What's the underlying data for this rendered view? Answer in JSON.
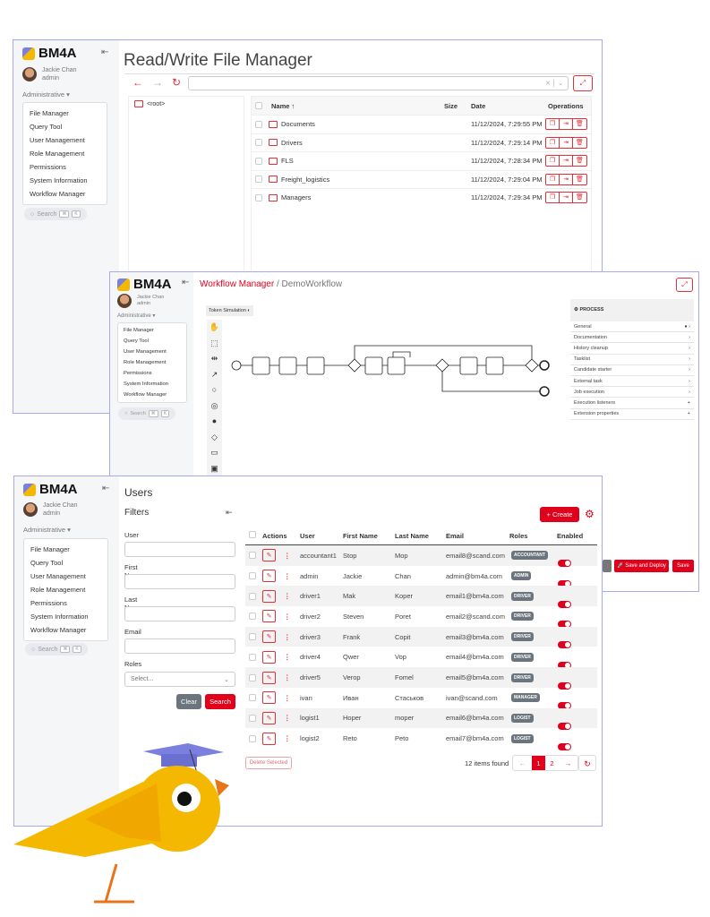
{
  "brand": "BM4A",
  "user": {
    "name": "Jackie Chan",
    "role": "admin"
  },
  "admin_menu": "Administrative ▾",
  "menu": [
    "File Manager",
    "Query Tool",
    "User Management",
    "Role Management",
    "Permissions",
    "System Information",
    "Workflow Manager"
  ],
  "search": {
    "label": "Search",
    "k1": "⌘",
    "k2": "K"
  },
  "file_manager": {
    "title": "Read/Write File Manager",
    "root": "<root>",
    "columns": {
      "name": "Name ↑",
      "size": "Size",
      "date": "Date",
      "ops": "Operations"
    },
    "rows": [
      {
        "name": "Documents",
        "date": "11/12/2024, 7:29:55 PM"
      },
      {
        "name": "Drivers",
        "date": "11/12/2024, 7:29:14 PM"
      },
      {
        "name": "FLS",
        "date": "11/12/2024, 7:28:34 PM"
      },
      {
        "name": "Freight_logistics",
        "date": "11/12/2024, 7:29:04 PM"
      },
      {
        "name": "Managers",
        "date": "11/12/2024, 7:29:34 PM"
      }
    ]
  },
  "workflow": {
    "crumb": "Workflow Manager",
    "sep": " / ",
    "name": "DemoWorkflow",
    "token_sim": "Token Simulation",
    "process": "PROCESS",
    "props": [
      {
        "l": "General",
        "i": "● ›"
      },
      {
        "l": "Documentation",
        "i": "›"
      },
      {
        "l": "History cleanup",
        "i": "›"
      },
      {
        "l": "Tasklist",
        "i": "›"
      },
      {
        "l": "Candidate starter",
        "i": "›"
      },
      {
        "l": "External task",
        "i": "›"
      },
      {
        "l": "Job execution",
        "i": "›"
      },
      {
        "l": "Execution listeners",
        "i": "+"
      },
      {
        "l": "Extension properties",
        "i": "+"
      }
    ],
    "save_deploy": "Save and Deploy",
    "save": "Save"
  },
  "users": {
    "title": "Users",
    "filters": "Filters",
    "f_user": "User",
    "f_first": "First Name",
    "f_last": "Last Name",
    "f_email": "Email",
    "f_roles": "Roles",
    "select_ph": "Select...",
    "clear": "Clear",
    "search": "Search",
    "create": "+ Create",
    "columns": [
      "Actions",
      "User",
      "First Name",
      "Last Name",
      "Email",
      "Roles",
      "Enabled"
    ],
    "rows": [
      [
        "accountant1",
        "Stop",
        "Mop",
        "email8@scand.com",
        "ACCOUNTANT"
      ],
      [
        "admin",
        "Jackie",
        "Chan",
        "admin@bm4a.com",
        "ADMIN"
      ],
      [
        "driver1",
        "Mak",
        "Koper",
        "email1@bm4a.com",
        "DRIVER"
      ],
      [
        "driver2",
        "Steven",
        "Poret",
        "email2@scand.com",
        "DRIVER"
      ],
      [
        "driver3",
        "Frank",
        "Copit",
        "email3@bm4a.com",
        "DRIVER"
      ],
      [
        "driver4",
        "Qwer",
        "Vop",
        "email4@bm4a.com",
        "DRIVER"
      ],
      [
        "driver5",
        "Verop",
        "Fomel",
        "email5@bm4a.com",
        "DRIVER"
      ],
      [
        "ivan",
        "Иван",
        "Стаськов",
        "ivan@scand.com",
        "MANAGER"
      ],
      [
        "logist1",
        "Hoper",
        "moper",
        "email6@bm4a.com",
        "LOGIST"
      ],
      [
        "logist2",
        "Reto",
        "Peto",
        "email7@bm4a.com",
        "LOGIST"
      ]
    ],
    "delete_selected": "Delete Selected",
    "found": "12 items found",
    "pages": [
      "1",
      "2"
    ]
  },
  "colors": {
    "accent": "#e0001b",
    "frame": "#a9a9f2",
    "bird": "#f5b800",
    "cap": "#7b7fe0"
  }
}
